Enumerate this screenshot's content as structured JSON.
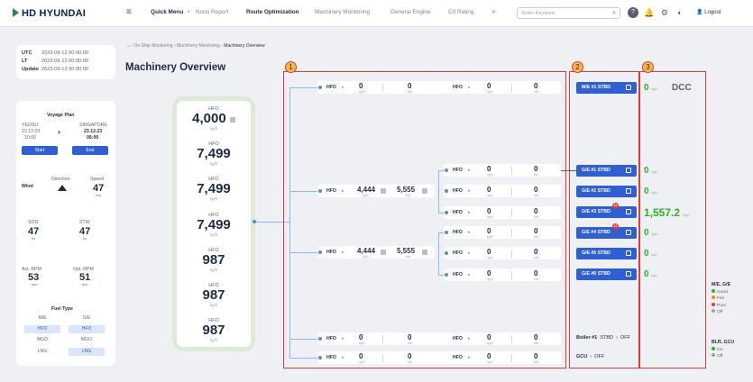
{
  "header": {
    "logo": "HD HYUNDAI",
    "nav": [
      "Quick Menu",
      "Noon Report",
      "Route Optimization",
      "Machinery Monitoring",
      "General Engine",
      "CII Rating"
    ],
    "active_nav": "Route Optimization",
    "more": "»",
    "search_placeholder": "Enter Keyword",
    "logout": "Logout"
  },
  "info": {
    "utc_label": "UTC",
    "utc": "2023-09-12 00:00:00",
    "lt_label": "LT",
    "lt": "2023-09-12 00:00:00",
    "update_label": "Update",
    "update": "2023-09-12 00:00:00"
  },
  "voyage": {
    "title": "Voyage Plan",
    "from": "YEOSU",
    "to": "SINGAPORE",
    "from_date": "23.12.03",
    "from_time": "10:00",
    "to_date": "23.12.23",
    "to_time": "06:00",
    "start": "Start",
    "end": "End",
    "wind_label": "Wind",
    "direction_label": "Direction",
    "speed_label": "Speed",
    "speed": "47",
    "speed_unit": "m/s",
    "sog_label": "SOG",
    "sog": "47",
    "sog_unit": "kn",
    "stw_label": "STW",
    "stw": "47",
    "stw_unit": "kn",
    "act_rpm_label": "Act. RPM",
    "act_rpm": "53",
    "act_rpm_unit": "rpm",
    "opt_rpm_label": "Opt. RPM",
    "opt_rpm": "51",
    "opt_rpm_unit": "rpm",
    "fuel_title": "Fuel Type",
    "fuel_cols": [
      "M/E",
      "G/E"
    ],
    "fuel_rows": [
      [
        "HFO",
        "HFO"
      ],
      [
        "MGO",
        "MGO"
      ],
      [
        "LNG",
        "LNG"
      ]
    ]
  },
  "breadcrumb": [
    "On-Ship Monitoring",
    "Machinery Monitoring",
    "Machinery Overview"
  ],
  "page_title": "Machinery Overview",
  "hfo_list": [
    {
      "label": "HFO",
      "value": "4,000",
      "unit": "kg/h"
    },
    {
      "label": "HFO",
      "value": "7,499",
      "unit": "kg/h"
    },
    {
      "label": "HFO",
      "value": "7,499",
      "unit": "kg/h"
    },
    {
      "label": "HFO",
      "value": "7,499",
      "unit": "kg/h"
    },
    {
      "label": "HFO",
      "value": "987",
      "unit": "kg/h"
    },
    {
      "label": "HFO",
      "value": "987",
      "unit": "kg/h"
    },
    {
      "label": "HFO",
      "value": "987",
      "unit": "kg/h"
    }
  ],
  "sections": [
    "1",
    "2",
    "3"
  ],
  "flow": {
    "fuel": "HFO",
    "zero": "0",
    "kgh": "kg/h",
    "kw": "kW",
    "merge1_flow": "4,444",
    "merge1_power": "5,555",
    "merge2_flow": "4,444",
    "merge2_power": "5,555"
  },
  "equipment": [
    {
      "name": "M/E #1 STBD",
      "value": "0",
      "unit": "kg/h",
      "extra": "DCC"
    },
    {
      "name": "G/E #1 STBD",
      "value": "0",
      "unit": "kg/h"
    },
    {
      "name": "G/E #2 STBD",
      "value": "0",
      "unit": "kg/h"
    },
    {
      "name": "G/E #3 STBD",
      "value": "1,557.2",
      "unit": "kg/h",
      "badge": "41"
    },
    {
      "name": "G/E #4 STBD",
      "value": "0",
      "unit": "kg/h",
      "badge": "41"
    },
    {
      "name": "G/E #5 STBD",
      "value": "0",
      "unit": "kg/h"
    },
    {
      "name": "G/E #6 STBD",
      "value": "0",
      "unit": "kg/h"
    }
  ],
  "boiler": {
    "name": "Boiler #1",
    "side": "STBD",
    "status": "OFF"
  },
  "gcu": {
    "name": "GCU",
    "status": "OFF"
  },
  "legend": {
    "me_ge": "M/E, G/E",
    "me_items": [
      {
        "label": "Good",
        "color": "#2bb32b"
      },
      {
        "label": "Fire",
        "color": "#f08a24"
      },
      {
        "label": "Poor",
        "color": "#e03a3a"
      },
      {
        "label": "Off",
        "color": "#9aa3b2"
      }
    ],
    "blr": "BLR, GCU",
    "blr_items": [
      {
        "label": "On",
        "color": "#2bb32b"
      },
      {
        "label": "Off",
        "color": "#9aa3b2"
      }
    ]
  }
}
